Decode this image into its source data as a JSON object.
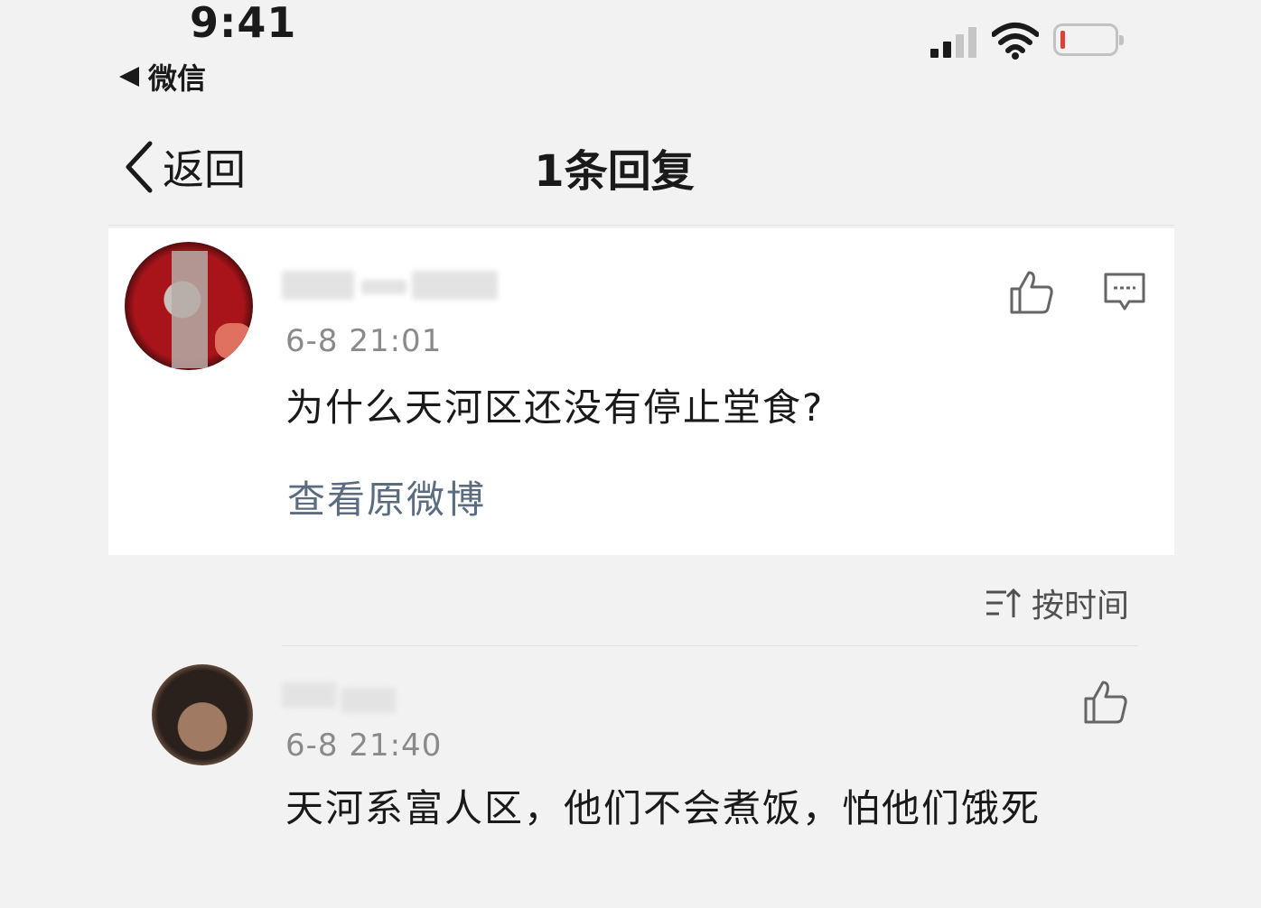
{
  "status_bar": {
    "time": "9:41",
    "back_app_label": "微信"
  },
  "nav": {
    "back_label": "返回",
    "title": "1条回复"
  },
  "original_post": {
    "date": "6-8 21:01",
    "content": "为什么天河区还没有停止堂食?",
    "view_original_label": "查看原微博"
  },
  "sort": {
    "label": "按时间"
  },
  "reply": {
    "date": "6-8 21:40",
    "content": "天河系富人区，他们不会煮饭，怕他们饿死"
  },
  "colors": {
    "background": "#f2f2f2",
    "card": "#ffffff",
    "link": "#5b6b80",
    "meta_text": "#8a8a8a",
    "battery_low": "#e0403a"
  },
  "icons": [
    "signal-icon",
    "wifi-icon",
    "battery-icon",
    "chevron-left-icon",
    "thumbs-up-icon",
    "comment-icon",
    "sort-icon"
  ]
}
